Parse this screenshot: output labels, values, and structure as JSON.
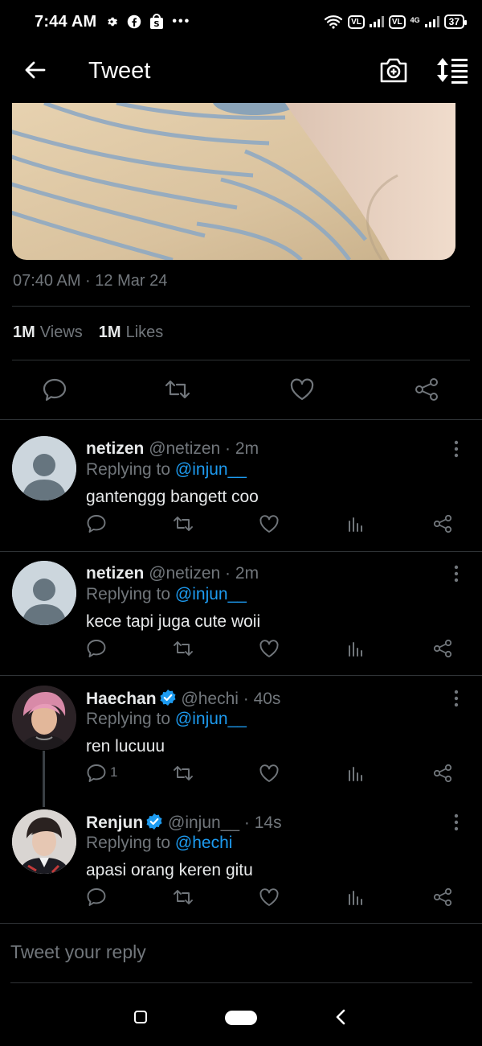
{
  "status_bar": {
    "time": "7:44 AM",
    "left_icons": [
      "gear-icon",
      "facebook-icon",
      "shop-icon",
      "more-dots-icon"
    ],
    "right_icons": [
      "wifi-icon",
      "volte-icon",
      "signal-icon",
      "volte-icon",
      "4g-signal-icon"
    ],
    "volte_label": "VL",
    "network_label": "4G",
    "battery": "37"
  },
  "header": {
    "title": "Tweet",
    "icons": [
      "back-arrow-icon",
      "camera-add-icon",
      "sort-icon"
    ]
  },
  "tweet": {
    "timestamp": "07:40 AM · 12 Mar 24",
    "views_count": "1M",
    "views_label": "Views",
    "likes_count": "1M",
    "likes_label": "Likes",
    "actions": [
      "reply-icon",
      "retweet-icon",
      "like-icon",
      "share-icon"
    ]
  },
  "replies": [
    {
      "name": "netizen",
      "handle": "@netizen · 2m",
      "replying_prefix": "Replying to ",
      "replying_to": "@injun__",
      "text": "gantenggg bangett coo",
      "reply_count": "",
      "verified": false
    },
    {
      "name": "netizen",
      "handle": "@netizen · 2m",
      "replying_prefix": "Replying to ",
      "replying_to": "@injun__",
      "text": "kece tapi juga cute woii",
      "reply_count": "",
      "verified": false
    },
    {
      "name": "Haechan",
      "handle": "@hechi · 40s",
      "replying_prefix": "Replying to ",
      "replying_to": "@injun__",
      "text": "ren lucuuu",
      "reply_count": "1",
      "verified": true
    },
    {
      "name": "Renjun",
      "handle": "@injun__ · 14s",
      "replying_prefix": "Replying to ",
      "replying_to": "@hechi",
      "text": "apasi orang keren gitu",
      "reply_count": "",
      "verified": true
    }
  ],
  "compose": {
    "placeholder": "Tweet your reply"
  },
  "colors": {
    "background": "#000000",
    "text": "#e7e9ea",
    "muted": "#71767b",
    "link": "#1d9bf0",
    "divider": "#2f3336"
  }
}
